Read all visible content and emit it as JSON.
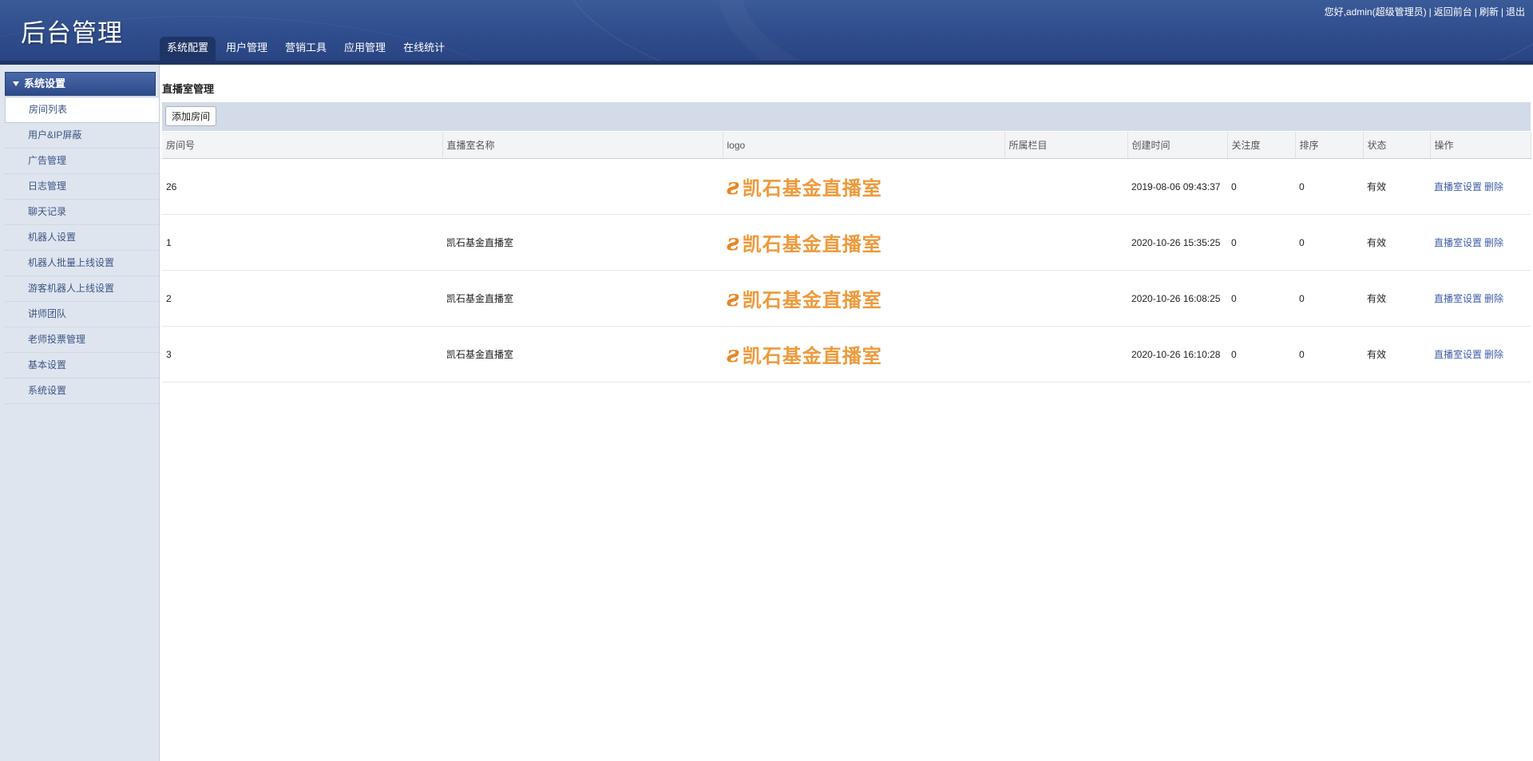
{
  "header": {
    "title": "后台管理",
    "greeting": "您好,admin(超级管理员)",
    "links": [
      "返回前台",
      "刷新",
      "退出"
    ],
    "tabs": [
      {
        "label": "系统配置",
        "active": true
      },
      {
        "label": "用户管理",
        "active": false
      },
      {
        "label": "营销工具",
        "active": false
      },
      {
        "label": "应用管理",
        "active": false
      },
      {
        "label": "在线统计",
        "active": false
      }
    ]
  },
  "sidebar": {
    "section": "系统设置",
    "items": [
      {
        "label": "房间列表",
        "active": true
      },
      {
        "label": "用户&IP屏蔽",
        "active": false
      },
      {
        "label": "广告管理",
        "active": false
      },
      {
        "label": "日志管理",
        "active": false
      },
      {
        "label": "聊天记录",
        "active": false
      },
      {
        "label": "机器人设置",
        "active": false
      },
      {
        "label": "机器人批量上线设置",
        "active": false
      },
      {
        "label": "游客机器人上线设置",
        "active": false
      },
      {
        "label": "讲师团队",
        "active": false
      },
      {
        "label": "老师投票管理",
        "active": false
      },
      {
        "label": "基本设置",
        "active": false
      },
      {
        "label": "系统设置",
        "active": false
      }
    ]
  },
  "main": {
    "title": "直播室管理",
    "add_button": "添加房间",
    "columns": [
      "房间号",
      "直播室名称",
      "logo",
      "所属栏目",
      "创建时间",
      "关注度",
      "排序",
      "状态",
      "操作"
    ],
    "rows": [
      {
        "id": "26",
        "name": "",
        "logo_text": "凯石基金直播室",
        "category": "",
        "created": "2019-08-06 09:43:37",
        "follows": "0",
        "order": "0",
        "status": "有效",
        "actions": [
          "直播室设置",
          "删除"
        ]
      },
      {
        "id": "1",
        "name": "凯石基金直播室",
        "logo_text": "凯石基金直播室",
        "category": "",
        "created": "2020-10-26 15:35:25",
        "follows": "0",
        "order": "0",
        "status": "有效",
        "actions": [
          "直播室设置",
          "删除"
        ]
      },
      {
        "id": "2",
        "name": "凯石基金直播室",
        "logo_text": "凯石基金直播室",
        "category": "",
        "created": "2020-10-26 16:08:25",
        "follows": "0",
        "order": "0",
        "status": "有效",
        "actions": [
          "直播室设置",
          "删除"
        ]
      },
      {
        "id": "3",
        "name": "凯石基金直播室",
        "logo_text": "凯石基金直播室",
        "category": "",
        "created": "2020-10-26 16:10:28",
        "follows": "0",
        "order": "0",
        "status": "有效",
        "actions": [
          "直播室设置",
          "删除"
        ]
      }
    ]
  },
  "colors": {
    "header": "#2f4d8c",
    "active_tab": "#1f3566",
    "sidebar_bg": "#dee5ef",
    "link": "#3d5ea8",
    "logo": "#e88624"
  }
}
